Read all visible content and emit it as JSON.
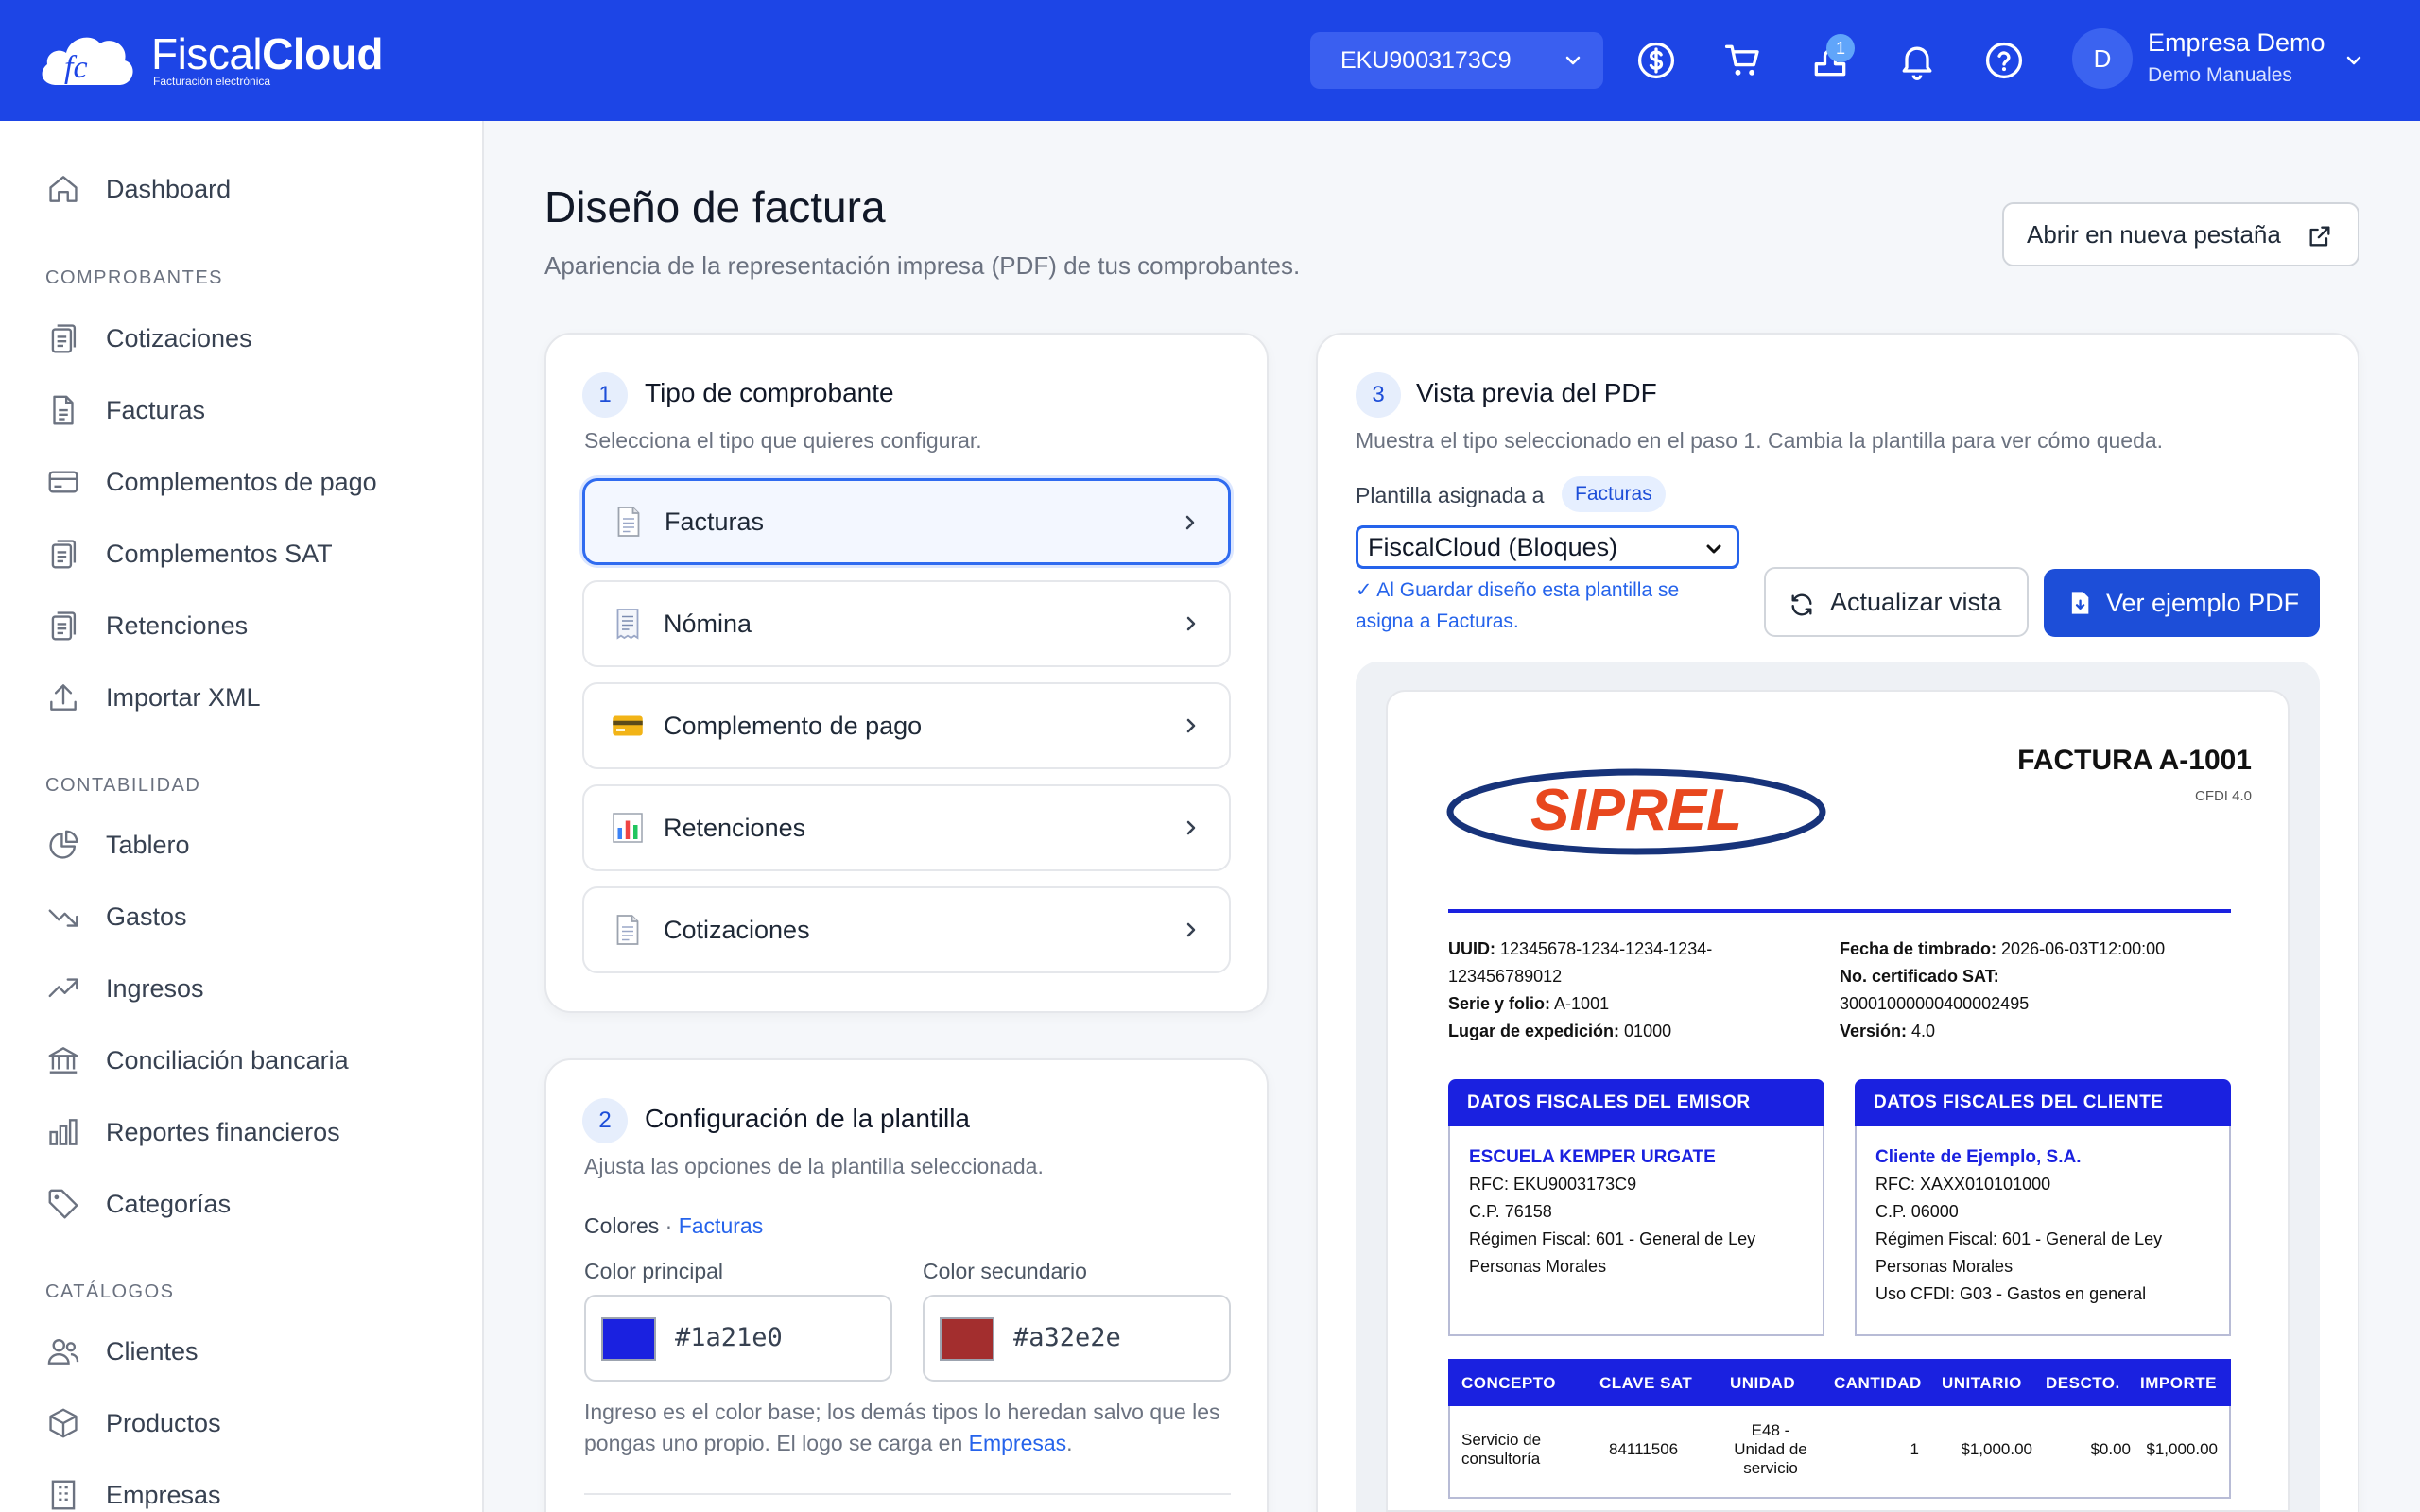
{
  "brand": {
    "name_light": "Fiscal",
    "name_bold": "Cloud",
    "tagline": "Facturación electrónica"
  },
  "topbar": {
    "rfc_selected": "EKU9003173C9",
    "icons": [
      "dollar-circle-icon",
      "cart-icon",
      "stamps-icon",
      "bell-icon",
      "help-icon"
    ],
    "stamps_badge": "1",
    "avatar_initial": "D",
    "user_name": "Empresa Demo",
    "user_sub": "Demo Manuales"
  },
  "sidebar": {
    "top": [
      {
        "label": "Dashboard",
        "icon": "home-icon"
      }
    ],
    "sections": [
      {
        "title": "COMPROBANTES",
        "items": [
          {
            "label": "Cotizaciones",
            "icon": "clipboard-icon"
          },
          {
            "label": "Facturas",
            "icon": "document-icon"
          },
          {
            "label": "Complementos de pago",
            "icon": "card-icon"
          },
          {
            "label": "Complementos SAT",
            "icon": "clipboard-icon"
          },
          {
            "label": "Retenciones",
            "icon": "clipboard-icon"
          },
          {
            "label": "Importar XML",
            "icon": "upload-icon"
          }
        ]
      },
      {
        "title": "CONTABILIDAD",
        "items": [
          {
            "label": "Tablero",
            "icon": "pie-chart-icon"
          },
          {
            "label": "Gastos",
            "icon": "trend-down-icon"
          },
          {
            "label": "Ingresos",
            "icon": "trend-up-icon"
          },
          {
            "label": "Conciliación bancaria",
            "icon": "bank-icon"
          },
          {
            "label": "Reportes financieros",
            "icon": "bar-chart-icon"
          },
          {
            "label": "Categorías",
            "icon": "tag-icon"
          }
        ]
      },
      {
        "title": "CATÁLOGOS",
        "items": [
          {
            "label": "Clientes",
            "icon": "users-icon"
          },
          {
            "label": "Productos",
            "icon": "box-icon"
          },
          {
            "label": "Empresas",
            "icon": "building-icon"
          }
        ]
      }
    ]
  },
  "page": {
    "title": "Diseño de factura",
    "subtitle": "Apariencia de la representación impresa (PDF) de tus comprobantes.",
    "open_tab_label": "Abrir en nueva pestaña"
  },
  "step1": {
    "number": "1",
    "title": "Tipo de comprobante",
    "subtitle": "Selecciona el tipo que quieres configurar.",
    "types": [
      {
        "label": "Facturas",
        "icon": "page-icon",
        "active": true
      },
      {
        "label": "Nómina",
        "icon": "receipt-icon",
        "active": false
      },
      {
        "label": "Complemento de pago",
        "icon": "credit-card-icon",
        "active": false
      },
      {
        "label": "Retenciones",
        "icon": "chart-icon",
        "active": false
      },
      {
        "label": "Cotizaciones",
        "icon": "page-icon",
        "active": false
      }
    ]
  },
  "step2": {
    "number": "2",
    "title": "Configuración de la plantilla",
    "subtitle": "Ajusta las opciones de la plantilla seleccionada.",
    "colors_label": "Colores",
    "colors_sep": " · ",
    "colors_scope": "Facturas",
    "primary_label": "Color principal",
    "primary_value": "#1a21e0",
    "secondary_label": "Color secundario",
    "secondary_value": "#a32e2e",
    "help_prefix": "Ingreso es el color base; los demás tipos lo heredan salvo que les pongas uno propio. El logo se carga en ",
    "help_link": "Empresas",
    "help_suffix": "."
  },
  "step3": {
    "number": "3",
    "title": "Vista previa del PDF",
    "subtitle": "Muestra el tipo seleccionado en el paso 1. Cambia la plantilla para ver cómo queda.",
    "assigned_label": "Plantilla asignada a",
    "assigned_pill": "Facturas",
    "template_selected": "FiscalCloud (Bloques)",
    "template_note": "✓ Al Guardar diseño esta plantilla se asigna a Facturas.",
    "refresh_label": "Actualizar vista",
    "pdf_label": "Ver ejemplo PDF"
  },
  "invoice": {
    "logo_text": "SIPREL",
    "title": "FACTURA A-1001",
    "cfdi": "CFDI 4.0",
    "uuid_label": "UUID:",
    "uuid_line1": "12345678-1234-1234-1234-",
    "uuid_line2": "123456789012",
    "serie_label": "Serie y folio:",
    "serie": "A-1001",
    "lugar_label": "Lugar de expedición:",
    "lugar": "01000",
    "fecha_label": "Fecha de timbrado:",
    "fecha": "2026-06-03T12:00:00",
    "cert_label": "No. certificado SAT:",
    "cert": "30001000000400002495",
    "version_label": "Versión:",
    "version": "4.0",
    "emisor_head": "DATOS FISCALES DEL EMISOR",
    "emisor": {
      "name": "ESCUELA KEMPER URGATE",
      "rfc": "RFC: EKU9003173C9",
      "cp": "C.P. 76158",
      "regimen1": "Régimen Fiscal: 601 - General de Ley",
      "regimen2": "Personas Morales"
    },
    "cliente_head": "DATOS FISCALES DEL CLIENTE",
    "cliente": {
      "name": "Cliente de Ejemplo, S.A.",
      "rfc": "RFC: XAXX010101000",
      "cp": "C.P. 06000",
      "regimen1": "Régimen Fiscal: 601 - General de Ley",
      "regimen2": "Personas Morales",
      "uso": "Uso CFDI: G03 - Gastos en general"
    },
    "columns": [
      "CONCEPTO",
      "CLAVE SAT",
      "UNIDAD",
      "CANTIDAD",
      "UNITARIO",
      "DESCTO.",
      "IMPORTE"
    ],
    "row": {
      "concepto1": "Servicio de",
      "concepto2": "consultoría",
      "clave": "84111506",
      "unidad1": "E48 -",
      "unidad2": "Unidad de",
      "unidad3": "servicio",
      "cantidad": "1",
      "unitario": "$1,000.00",
      "descto": "$0.00",
      "importe": "$1,000.00"
    }
  },
  "colors": {
    "topbar": "#1d45e6",
    "accent": "#1d4ed8",
    "invoice_primary": "#1a21e0",
    "invoice_secondary": "#a32e2e",
    "logo_red": "#e8471e",
    "logo_navy": "#17337a"
  }
}
